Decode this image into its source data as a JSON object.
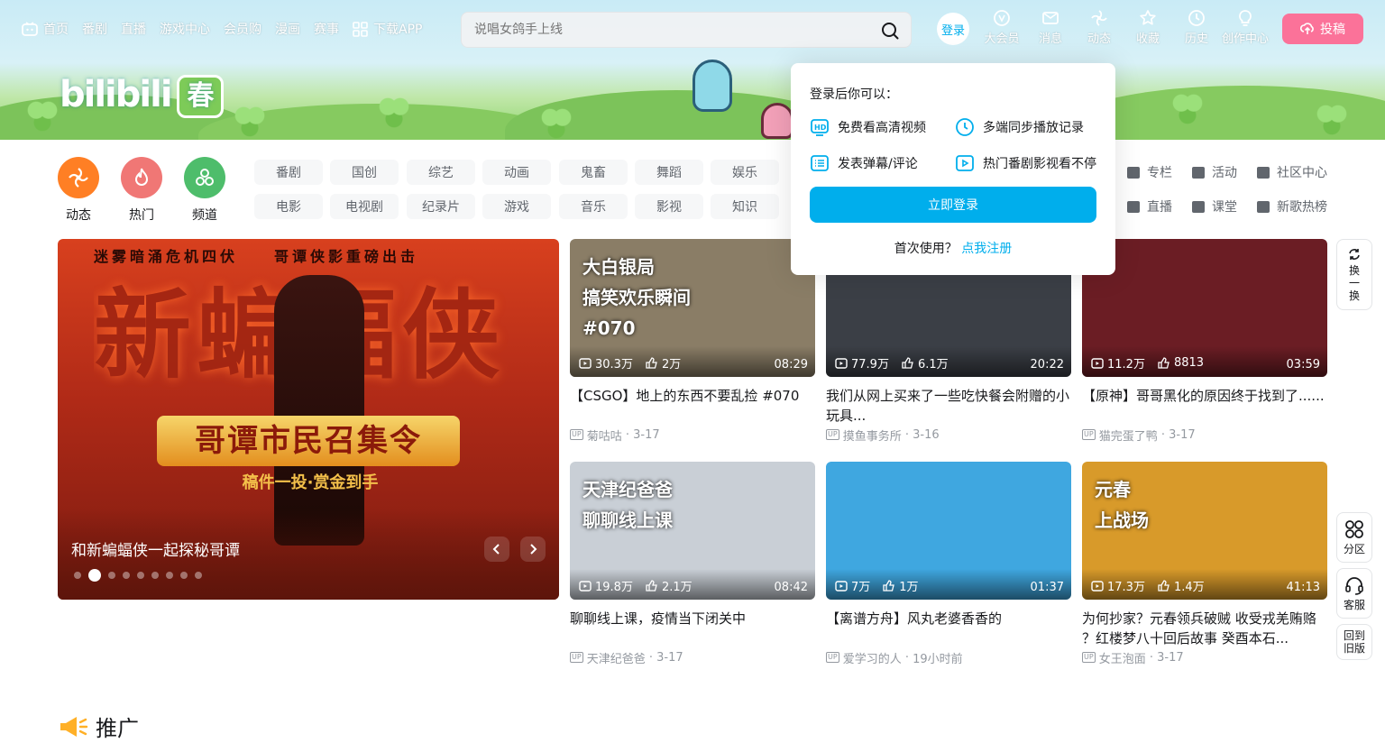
{
  "nav": {
    "left_items": [
      {
        "label": "首页",
        "icon": "tv-icon"
      },
      {
        "label": "番剧"
      },
      {
        "label": "直播"
      },
      {
        "label": "游戏中心"
      },
      {
        "label": "会员购"
      },
      {
        "label": "漫画"
      },
      {
        "label": "赛事"
      },
      {
        "label": "下载APP",
        "icon": "app-grid-icon"
      }
    ],
    "search_placeholder": "说唱女鸽手上线",
    "login_label": "登录",
    "right_items": [
      {
        "label": "大会员",
        "icon": "vip-icon"
      },
      {
        "label": "消息",
        "icon": "message-icon"
      },
      {
        "label": "动态",
        "icon": "dynamic-icon"
      },
      {
        "label": "收藏",
        "icon": "star-icon"
      },
      {
        "label": "历史",
        "icon": "clock-icon"
      },
      {
        "label": "创作中心",
        "icon": "bulb-icon"
      }
    ],
    "upload_label": "投稿"
  },
  "header": {
    "logo_text": "bilibili",
    "logo_badge": "春"
  },
  "channels": {
    "big": [
      {
        "label": "动态",
        "color": "#ff7f24"
      },
      {
        "label": "热门",
        "color": "#f07775"
      },
      {
        "label": "频道",
        "color": "#4ebd6b"
      }
    ],
    "row1": [
      "番剧",
      "国创",
      "综艺",
      "动画",
      "鬼畜",
      "舞蹈",
      "娱乐"
    ],
    "row2": [
      "电影",
      "电视剧",
      "纪录片",
      "游戏",
      "音乐",
      "影视",
      "知识"
    ],
    "right_links": [
      "专栏",
      "活动",
      "社区中心",
      "直播",
      "课堂",
      "新歌热榜"
    ]
  },
  "banner": {
    "top_text": "迷雾暗涌危机四伏　　哥谭侠影重磅出击",
    "big_text": "新蝙蝠侠",
    "call_text": "哥谭市民召集令",
    "sub_text": "稿件一投·赏金到手",
    "title": "和新蝙蝠侠一起探秘哥谭",
    "dot_count": 9,
    "active_dot": 1
  },
  "videos": [
    {
      "title": "【CSGO】地上的东西不要乱捡 #070",
      "views": "30.3万",
      "likes": "2万",
      "duration": "08:29",
      "author": "菊咕咕",
      "date": "3-17",
      "caption": "大白银局\n搞笑欢乐瞬间\n#070",
      "bg": "#8a7d66"
    },
    {
      "title": "我们从网上买来了一些吃快餐会附赠的小玩具...",
      "views": "77.9万",
      "likes": "6.1万",
      "duration": "20:22",
      "author": "摸鱼事务所",
      "date": "3-16",
      "caption": "",
      "bg": "#3b3f46"
    },
    {
      "title": "【原神】哥哥黑化的原因终于找到了......",
      "views": "11.2万",
      "likes": "8813",
      "duration": "03:59",
      "author": "猫完蛋了鸭",
      "date": "3-17",
      "caption": "",
      "bg": "#6b1d24"
    },
    {
      "title": "聊聊线上课，疫情当下闭关中",
      "views": "19.8万",
      "likes": "2.1万",
      "duration": "08:42",
      "author": "天津纪爸爸",
      "date": "3-17",
      "caption": "天津纪爸爸\n聊聊线上课",
      "bg": "#c9cfd6"
    },
    {
      "title": "【离谱方舟】风丸老婆香香的",
      "views": "7万",
      "likes": "1万",
      "duration": "01:37",
      "author": "爱学习的人",
      "date": "19小时前",
      "caption": "",
      "bg": "#3fa7e0"
    },
    {
      "title": "为何抄家？元春领兵破贼 收受戎羌贿赂 ？红楼梦八十回后故事 癸酉本石...",
      "views": "17.3万",
      "likes": "1.4万",
      "duration": "41:13",
      "author": "女王泡面",
      "date": "3-17",
      "caption": "元春\n上战场",
      "bg": "#d89a2a"
    }
  ],
  "login_popup": {
    "heading": "登录后你可以：",
    "features": [
      {
        "label": "免费看高清视频",
        "icon": "hd-icon"
      },
      {
        "label": "多端同步播放记录",
        "icon": "clock-icon"
      },
      {
        "label": "发表弹幕/评论",
        "icon": "list-icon"
      },
      {
        "label": "热门番剧影视看不停",
        "icon": "play-icon"
      }
    ],
    "button": "立即登录",
    "register_prompt": "首次使用？",
    "register_link": "点我注册"
  },
  "side": {
    "refresh": "换一换",
    "partition": "分区",
    "service": "客服",
    "old_version": "回到旧版"
  },
  "promo": {
    "title": "推广"
  }
}
